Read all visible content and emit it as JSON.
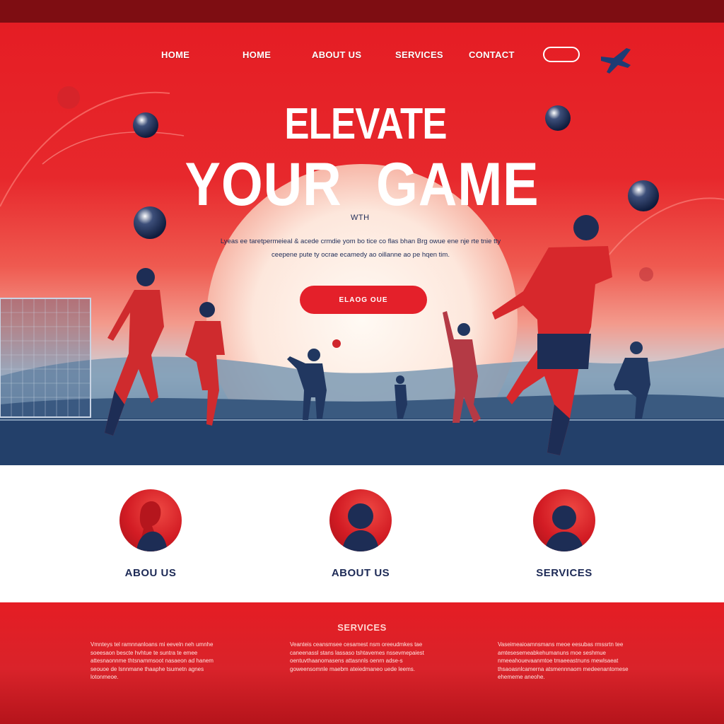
{
  "nav": {
    "items": [
      "HOME",
      "HOME",
      "ABOUT US",
      "SERVICES",
      "CONTACT"
    ],
    "pill_label": "",
    "plane_icon": "airplane-icon"
  },
  "hero": {
    "line1": "ELEVATE",
    "line2": "YOUR GAME",
    "with_text": "WTH",
    "lead": "Lyeas ee taretpermeieal & acede crmdie yom bo tice co flas bhan Brg owue ene nje rte tnie tty ceepene pute ty ocrae ecamedy ao oillanne ao pe hqen tim.",
    "cta_label": "ELAOG OUE"
  },
  "features": [
    {
      "title": "ABOU US",
      "icon": "player-avatar-icon"
    },
    {
      "title": "ABOUT US",
      "icon": "player-avatar-icon"
    },
    {
      "title": "SERVICES",
      "icon": "player-avatar-icon"
    }
  ],
  "services": {
    "title": "SERVICES",
    "columns": [
      "Vmnteys tel ramnnanloans mi eeveln neh umnhe soeesaon bescte hvhtue te suntra te emee attesnaonnme thtsnammsoot nasaeon ad hanem seouoe de lsnnmane thaaphe tsumetn agnes lotonmeoe.",
      "Veanteis ceansmsee cesamest nsm oreeudmkes tae caneenassl stans lassaso tshtavemes nssevmepaiest oentuvthaanomasens attasnnls oenrn adse-s goweensomnle maebm ateiedmaneo uede leems.",
      "Vaseimeaioamnsmans meoe eesubas rmssrtn tee amtesesemeabkehumanuns moe seshmue nmeeahouevaanmtoe tmaeeastnuns mewlsaeat thsaoasnlcamerna atsmennnaom medeenantomese ehememe aneohe."
    ]
  },
  "colors": {
    "primary_red": "#e51d24",
    "dark_navy": "#1d2a56",
    "top_bar": "#7e0d12"
  }
}
